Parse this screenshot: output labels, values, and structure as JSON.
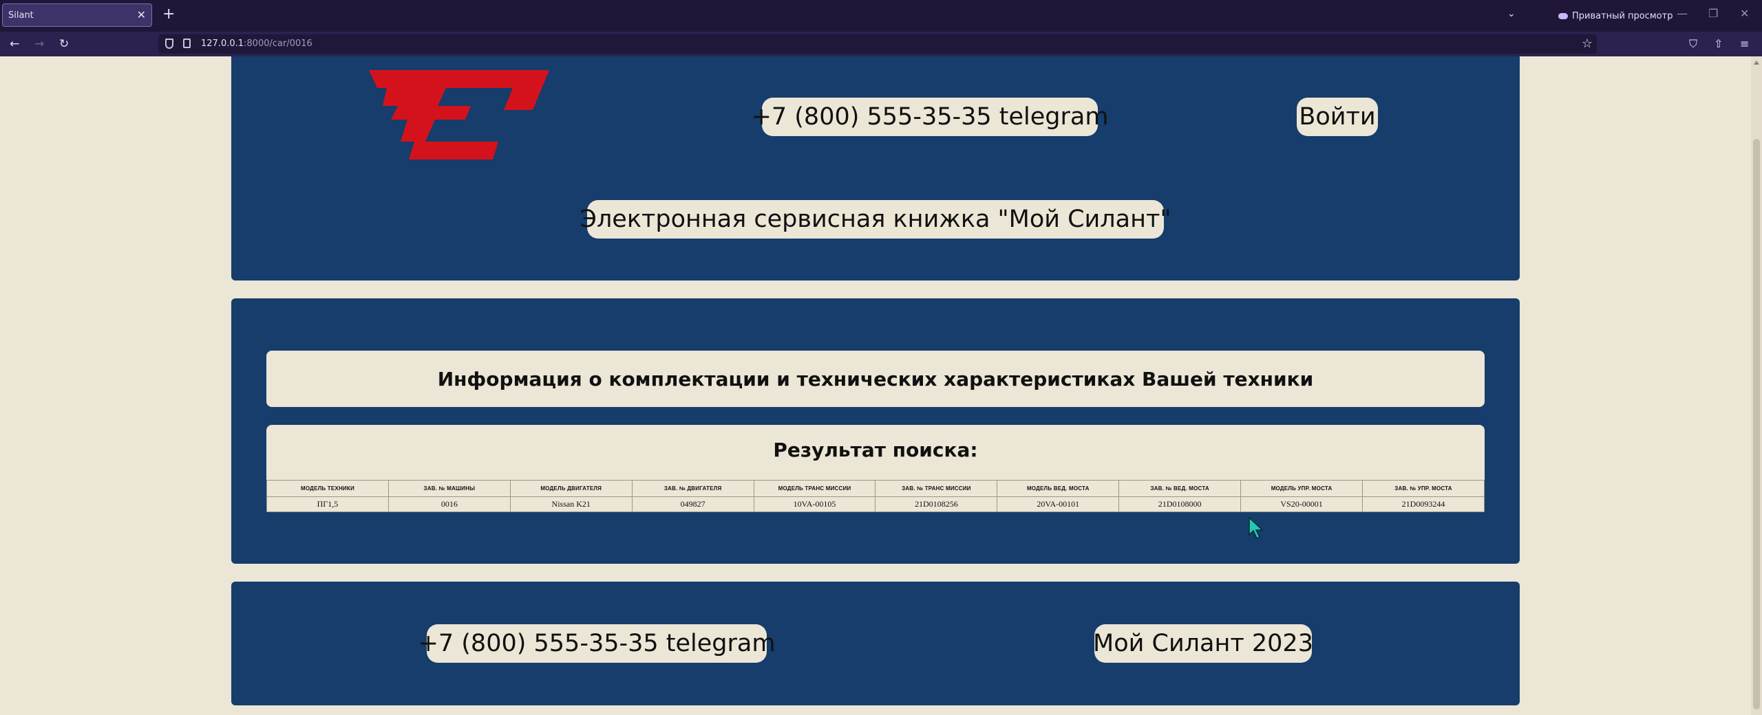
{
  "browser": {
    "tab_title": "Silant",
    "tab_close": "✕",
    "new_tab": "+",
    "tabs_list": "⌄",
    "private_label": "Приватный просмотр",
    "window_controls": [
      "—",
      "❐",
      "✕"
    ],
    "nav": {
      "back": "←",
      "forward": "→",
      "reload": "↻"
    },
    "url_host": "127.0.0.1",
    "url_rest": ":8000/car/0016",
    "bookmark_star": "☆",
    "toolbar_icons": [
      "⛉",
      "⇧",
      "≡"
    ]
  },
  "header": {
    "phone": "+7 (800) 555-35-35 telegram",
    "login": "Войти",
    "booklet_title": "Электронная сервисная книжка \"Мой Силант\""
  },
  "main": {
    "info_title": "Информация о комплектации и технических характеристиках Вашей техники",
    "results_title": "Результат поиска:",
    "table": {
      "columns": [
        "МОДЕЛЬ ТЕХНИКИ",
        "ЗАВ. № МАШИНЫ",
        "МОДЕЛЬ ДВИГАТЕЛЯ",
        "ЗАВ. № ДВИГАТЕЛЯ",
        "МОДЕЛЬ ТРАНС МИССИИ",
        "ЗАВ. № ТРАНС МИССИИ",
        "МОДЕЛЬ ВЕД. МОСТА",
        "ЗАВ. № ВЕД. МОСТА",
        "МОДЕЛЬ УПР. МОСТА",
        "ЗАВ. № УПР. МОСТА"
      ],
      "rows": [
        [
          "ПГ1,5",
          "0016",
          "Nissan K21",
          "049827",
          "10VA-00105",
          "21D0108256",
          "20VA-00101",
          "21D0108000",
          "VS20-00001",
          "21D0093244"
        ]
      ]
    }
  },
  "footer": {
    "phone": "+7 (800) 555-35-35 telegram",
    "copyright": "Мой Силант 2023"
  },
  "colors": {
    "page_bg": "#ece6d6",
    "panel_bg": "#163d6b",
    "logo_red": "#d4121c",
    "browser_dark": "#1f1638"
  }
}
